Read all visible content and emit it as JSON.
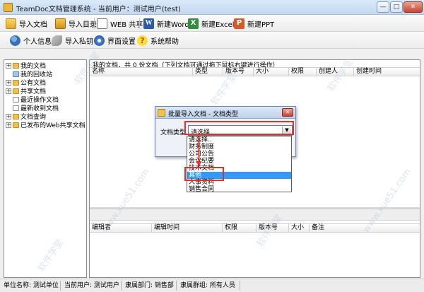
{
  "window": {
    "title": "TeamDoc文档管理系统 - 当前用户：测试用户(test)",
    "minimize": "—",
    "maximize": "□",
    "close": "✕"
  },
  "toolbar1": {
    "import_doc": "导入文档",
    "import_dir": "导入目录",
    "web_share": "WEB 共享",
    "new_word": "新建Word",
    "new_excel": "新建Excel",
    "new_ppt": "新建PPT",
    "word_glyph": "W",
    "excel_glyph": "X",
    "ppt_glyph": "P"
  },
  "toolbar2": {
    "personal_info": "个人信息",
    "import_key": "导入私钥",
    "ui_settings": "界面设置",
    "help": "系统帮助",
    "help_glyph": "?"
  },
  "tree": [
    {
      "label": "我的文档",
      "expander": "+",
      "icon": "folder"
    },
    {
      "label": "我的回收站",
      "expander": "",
      "icon": "recycle"
    },
    {
      "label": "公有文档",
      "expander": "+",
      "icon": "folder"
    },
    {
      "label": "共享文档",
      "expander": "+",
      "icon": "folder"
    },
    {
      "label": "最近操作文档",
      "expander": "",
      "icon": "doc"
    },
    {
      "label": "最新收到文档",
      "expander": "",
      "icon": "doc"
    },
    {
      "label": "文档查询",
      "expander": "+",
      "icon": "folder"
    },
    {
      "label": "已发布的Web共享文档",
      "expander": "+",
      "icon": "folder"
    }
  ],
  "doc_list": {
    "info": "我的文档，共 0 份文档（下列文档可通过拖下鼠标右键进行操作）",
    "columns": [
      "名称",
      "类型",
      "版本号",
      "大小",
      "权限",
      "创建人",
      "创建时间"
    ]
  },
  "version_list": {
    "columns": [
      "编辑者",
      "编辑时间",
      "权限",
      "版本号",
      "大小",
      "备注"
    ]
  },
  "dialog": {
    "title": "批量导入文档 - 文档类型",
    "close": "✕",
    "field_label": "文档类型",
    "selected": "请选择..",
    "options": [
      "请选择..",
      "财务制度",
      "公司公告",
      "会议纪要",
      "技术文档",
      "其他",
      "人事资料",
      "销售合同"
    ],
    "highlighted_index": 5
  },
  "status": {
    "unit": "单位名称: 测试单位",
    "user": "当前用户: 测试用户",
    "dept": "隶属部门: 销售部",
    "group": "隶属群组: 所有人员"
  },
  "watermark": {
    "text1": "软件学堂",
    "text2": "www.xue51.com"
  },
  "colors": {
    "highlight": "#3399ff",
    "callout": "#e0322c"
  }
}
